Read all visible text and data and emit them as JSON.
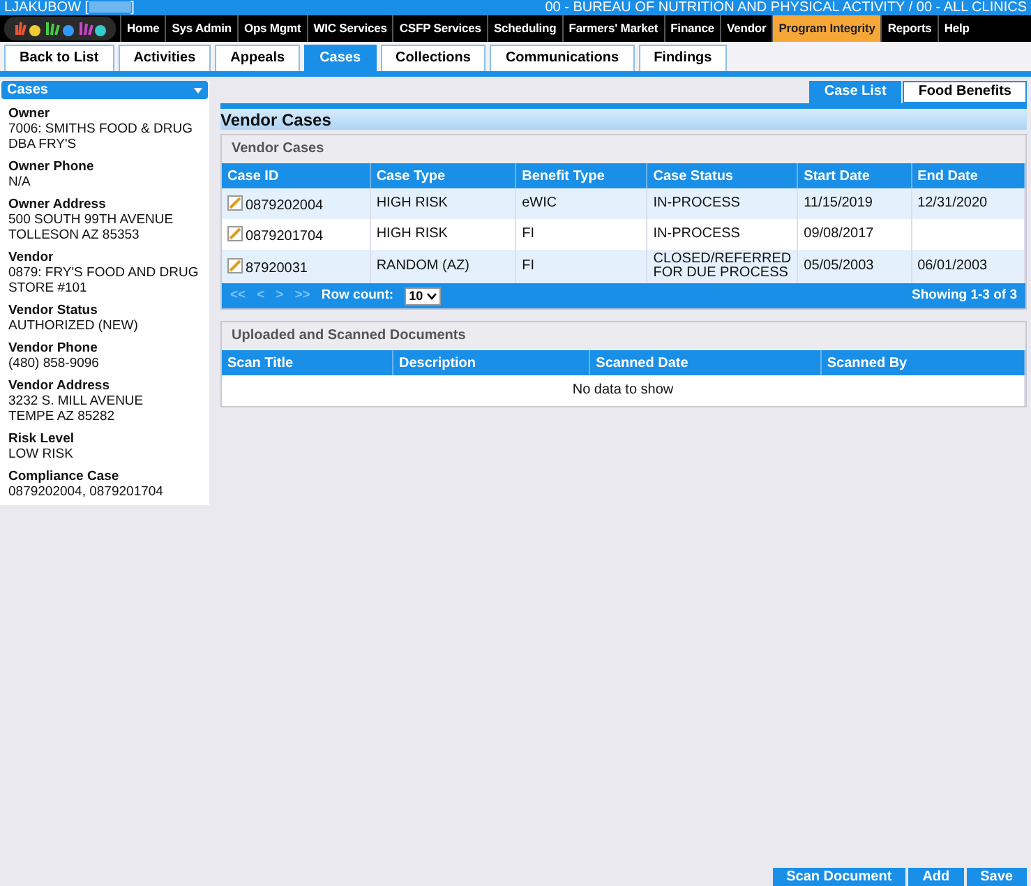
{
  "header": {
    "user": "LJAKUBOW [",
    "user_close": "]",
    "agency": "00 - BUREAU OF NUTRITION AND PHYSICAL ACTIVITY / 00 - ALL CLINICS"
  },
  "menu": [
    {
      "label": "Home",
      "selected": false
    },
    {
      "label": "Sys Admin",
      "selected": false
    },
    {
      "label": "Ops Mgmt",
      "selected": false
    },
    {
      "label": "WIC Services",
      "selected": false
    },
    {
      "label": "CSFP Services",
      "selected": false
    },
    {
      "label": "Scheduling",
      "selected": false
    },
    {
      "label": "Farmers' Market",
      "selected": false
    },
    {
      "label": "Finance",
      "selected": false
    },
    {
      "label": "Vendor",
      "selected": false
    },
    {
      "label": "Program Integrity",
      "selected": true
    },
    {
      "label": "Reports",
      "selected": false
    },
    {
      "label": "Help",
      "selected": false
    }
  ],
  "tabs": [
    {
      "label": "Back to List",
      "selected": false
    },
    {
      "label": "Activities",
      "selected": false
    },
    {
      "label": "Appeals",
      "selected": false
    },
    {
      "label": "Cases",
      "selected": true
    },
    {
      "label": "Collections",
      "selected": false
    },
    {
      "label": "Communications",
      "selected": false
    },
    {
      "label": "Findings",
      "selected": false
    }
  ],
  "sidebar": {
    "dropdown": "Cases",
    "fields": [
      {
        "label": "Owner",
        "lines": [
          "7006: SMITHS FOOD & DRUG DBA FRY'S"
        ]
      },
      {
        "label": "Owner Phone",
        "lines": [
          "N/A"
        ]
      },
      {
        "label": "Owner Address",
        "lines": [
          "500 SOUTH 99TH AVENUE",
          "TOLLESON AZ 85353"
        ]
      },
      {
        "label": "Vendor",
        "lines": [
          "0879: FRY'S FOOD AND DRUG STORE #101"
        ]
      },
      {
        "label": "Vendor Status",
        "lines": [
          "AUTHORIZED (NEW)"
        ]
      },
      {
        "label": "Vendor Phone",
        "lines": [
          "(480) 858-9096"
        ]
      },
      {
        "label": "Vendor Address",
        "lines": [
          "3232 S. MILL AVENUE",
          "TEMPE AZ 85282"
        ]
      },
      {
        "label": "Risk Level",
        "lines": [
          "LOW RISK"
        ]
      },
      {
        "label": "Compliance Case",
        "lines": [
          "0879202004, 0879201704"
        ]
      }
    ]
  },
  "view_tabs": [
    {
      "label": "Case List",
      "selected": true
    },
    {
      "label": "Food Benefits",
      "selected": false
    }
  ],
  "page_title": "Vendor Cases",
  "cases_panel": {
    "title": "Vendor Cases",
    "columns": [
      "Case ID",
      "Case Type",
      "Benefit Type",
      "Case Status",
      "Start Date",
      "End Date"
    ],
    "rows": [
      [
        "0879202004",
        "HIGH RISK",
        "eWIC",
        "IN-PROCESS",
        "11/15/2019",
        "12/31/2020"
      ],
      [
        "0879201704",
        "HIGH RISK",
        "FI",
        "IN-PROCESS",
        "09/08/2017",
        ""
      ],
      [
        "87920031",
        "RANDOM (AZ)",
        "FI",
        "CLOSED/REFERRED FOR DUE PROCESS",
        "05/05/2003",
        "06/01/2003"
      ]
    ],
    "pager": {
      "nav": [
        "<<",
        "<",
        ">",
        ">>"
      ],
      "nav_disabled": true,
      "row_count_label": "Row count:",
      "row_count": "10",
      "showing": "Showing 1-3 of 3"
    }
  },
  "docs_panel": {
    "title": "Uploaded and Scanned Documents",
    "columns": [
      "Scan Title",
      "Description",
      "Scanned Date",
      "Scanned By"
    ],
    "empty": "No data to show"
  },
  "buttons": [
    "Scan Document",
    "Add",
    "Save"
  ]
}
